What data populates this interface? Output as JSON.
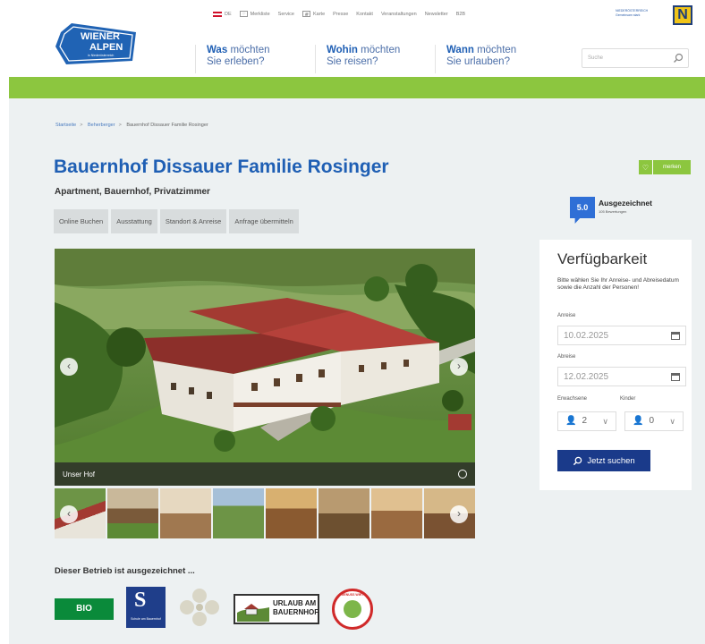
{
  "header": {
    "logo_text_1": "WIENER",
    "logo_text_2": "ALPEN",
    "logo_sub": "in Niederösterreich",
    "util_links": [
      {
        "label": "DE",
        "icon": "flag-icon"
      },
      {
        "label": "Merkliste",
        "icon": "bookmark-icon"
      },
      {
        "label": "Service",
        "icon": ""
      },
      {
        "label": "Karte",
        "icon": "map-icon"
      },
      {
        "label": "Presse",
        "icon": ""
      },
      {
        "label": "Kontakt",
        "icon": ""
      },
      {
        "label": "Veranstaltungen",
        "icon": ""
      },
      {
        "label": "Newsletter",
        "icon": ""
      },
      {
        "label": "B2B",
        "icon": ""
      }
    ],
    "noe_logo": {
      "line1": "NIEDERÖSTERREICH",
      "line2": "Gemeinsam stark",
      "letter": "N"
    },
    "nav": [
      {
        "bold": "Was",
        "rest": "möchten",
        "line2": "Sie erleben?"
      },
      {
        "bold": "Wohin",
        "rest": "möchten",
        "line2": "Sie reisen?"
      },
      {
        "bold": "Wann",
        "rest": "möchten",
        "line2": "Sie urlauben?"
      }
    ],
    "search_placeholder": "Suche"
  },
  "breadcrumb": {
    "items": [
      "Startseite",
      "Beherberger",
      "Bauernhof Dissauer Familie Rosinger"
    ]
  },
  "property": {
    "title": "Bauernhof Dissauer Familie Rosinger",
    "subtitle": "Apartment, Bauernhof, Privatzimmer",
    "merken_label": "merken",
    "tabs": [
      "Online Buchen",
      "Ausstattung",
      "Standort & Anreise",
      "Anfrage übermitteln"
    ],
    "rating": {
      "score": "5.0",
      "label": "Ausgezeichnet",
      "count": "105 Bewertungen"
    }
  },
  "gallery": {
    "caption": "Unser Hof",
    "thumb_count": 8
  },
  "availability": {
    "title": "Verfügbarkeit",
    "hint": "Bitte wählen Sie Ihr Anreise- und Abreisedatum sowie die Anzahl der Personen!",
    "arrival_label": "Anreise",
    "arrival_value": "10.02.2025",
    "departure_label": "Abreise",
    "departure_value": "12.02.2025",
    "adults_label": "Erwachsene",
    "adults_value": "2",
    "children_label": "Kinder",
    "children_value": "0",
    "search_button": "Jetzt suchen"
  },
  "awards": {
    "heading": "Dieser Betrieb ist ausgezeichnet ...",
    "bio_label": "BIO",
    "s_logo": {
      "letter": "S",
      "text": "Schule am Bauernhof"
    },
    "urlaub_text_1": "URLAUB AM",
    "urlaub_text_2": "BAUERNHOF",
    "genuss_text": "GENUSS WIRT"
  },
  "colors": {
    "brand_blue": "#1f5fb4",
    "green": "#8cc63f",
    "dark_blue_button": "#1a3a8a",
    "rating_blue": "#2f6fd6"
  }
}
